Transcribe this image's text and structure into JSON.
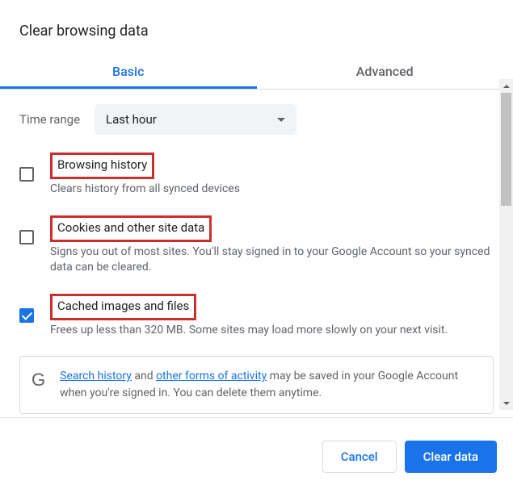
{
  "title": "Clear browsing data",
  "tabs": {
    "basic": "Basic",
    "advanced": "Advanced"
  },
  "timeRange": {
    "label": "Time range",
    "value": "Last hour"
  },
  "items": [
    {
      "title": "Browsing history",
      "desc": "Clears history from all synced devices",
      "checked": false
    },
    {
      "title": "Cookies and other site data",
      "desc": "Signs you out of most sites. You'll stay signed in to your Google Account so your synced data can be cleared.",
      "checked": false
    },
    {
      "title": "Cached images and files",
      "desc": "Frees up less than 320 MB. Some sites may load more slowly on your next visit.",
      "checked": true
    }
  ],
  "info": {
    "link1": "Search history",
    "mid1": " and ",
    "link2": "other forms of activity",
    "rest": " may be saved in your Google Account when you're signed in. You can delete them anytime."
  },
  "buttons": {
    "cancel": "Cancel",
    "clear": "Clear data"
  }
}
